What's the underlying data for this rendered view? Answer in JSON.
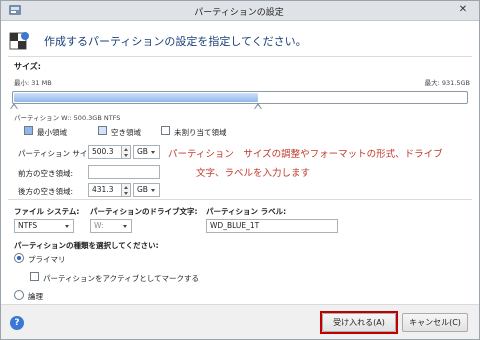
{
  "window": {
    "title": "パーティションの設定",
    "close": "✕"
  },
  "header": {
    "text": "作成するパーティションの設定を指定してください。"
  },
  "size": {
    "label": "サイズ:",
    "min_label": "最小: 31 MB",
    "max_label": "最大: 931.5GB",
    "partition_info": "パーティション W:: 500.3GB  NTFS",
    "filled_fraction": 0.537
  },
  "legend": {
    "min": "最小領域",
    "free": "空き領域",
    "unallocated": "未割り当て領域"
  },
  "fields": {
    "partition_size_label": "パーティション サイズ:",
    "partition_size_value": "500.3",
    "partition_size_unit": "GB",
    "free_before_label": "前方の空き領域:",
    "free_before_value": "",
    "free_after_label": "後方の空き領域:",
    "free_after_value": "431.3",
    "free_after_unit": "GB"
  },
  "annotation": {
    "line1": "パーティション　サイズの調整やフォーマットの形式、ドライブ",
    "line2": "文字、ラベルを入力します"
  },
  "format": {
    "fs_label": "ファイル システム:",
    "fs_value": "NTFS",
    "drive_label": "パーティションのドライブ文字:",
    "drive_value": "W:",
    "volume_label": "パーティション ラベル:",
    "volume_value": "WD_BLUE_1T"
  },
  "type": {
    "label": "パーティションの種類を選択してください:",
    "primary": "プライマリ",
    "active_check": "パーティションをアクティブとしてマークする",
    "logical": "論理"
  },
  "footer": {
    "help": "?",
    "ok": "受け入れる(A)",
    "cancel": "キャンセル(C)"
  }
}
